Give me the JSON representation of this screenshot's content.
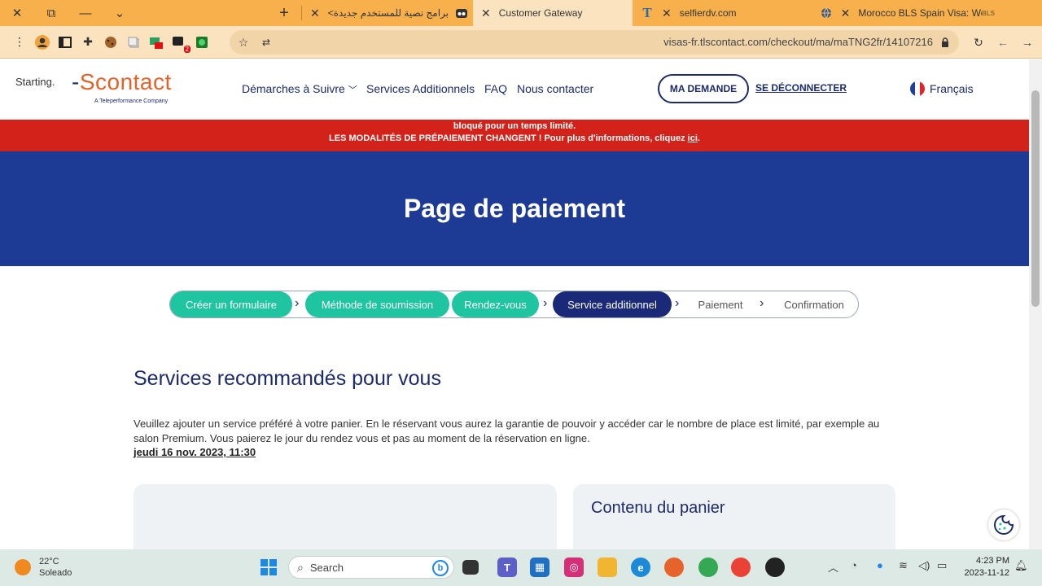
{
  "browser": {
    "tabs": [
      {
        "title": "برامج نصية للمستخدم جديدة>"
      },
      {
        "title": "Customer Gateway"
      },
      {
        "title": "selfierdv.com"
      },
      {
        "title": "Morocco BLS Spain Visa: Welcom"
      }
    ],
    "url": "visas-fr.tlscontact.com/checkout/ma/maTNG2fr/14107216",
    "extension_badge": "2",
    "bls_badge": "BLS"
  },
  "header": {
    "starting": "Starting.",
    "logo_main": "Scontact",
    "logo_sub": "A Teleperformance Company",
    "nav": [
      "Démarches à Suivre",
      "Services Additionnels",
      "FAQ",
      "Nous contacter"
    ],
    "ma_demande": "MA DEMANDE",
    "deconnect": "SE DÉCONNECTER",
    "language": "Français"
  },
  "alert": {
    "line1": "bloqué pour un temps limité.",
    "line2_prefix": "LES MODALITÉS DE PRÉPAIEMENT CHANGENT ! Pour plus d'informations, cliquez",
    "line2_link": "ici",
    "line2_suffix": "."
  },
  "hero": {
    "title": "Page de paiement"
  },
  "steps": [
    {
      "label": "Créer un formulaire",
      "state": "done"
    },
    {
      "label": "Méthode de soumission",
      "state": "done"
    },
    {
      "label": "Rendez-vous",
      "state": "done"
    },
    {
      "label": "Service additionnel",
      "state": "current"
    },
    {
      "label": "Paiement",
      "state": "todo"
    },
    {
      "label": "Confirmation",
      "state": "todo"
    }
  ],
  "content": {
    "title": "Services recommandés pour vous",
    "description": "Veuillez ajouter un service préféré à votre panier. En le réservant vous aurez la garantie de pouvoir y accéder car le nombre de place est limité, par exemple au salon Premium. Vous paierez le jour du rendez vous et pas au moment de la réservation en ligne.",
    "appointment_date": "jeudi 16 nov. 2023, 11:30",
    "cart_title": "Contenu du panier"
  },
  "taskbar": {
    "temperature": "22°C",
    "weather": "Soleado",
    "search_placeholder": "Search",
    "time": "4:23 PM",
    "date": "2023-11-12"
  },
  "colors": {
    "tab_bar": "#f7b04b",
    "brand_navy": "#1d2b6b",
    "hero_blue": "#1d3a94",
    "alert_red": "#d3221a",
    "step_done": "#1fc4a1",
    "step_current": "#1a2a78",
    "logo_orange": "#e0632a"
  }
}
